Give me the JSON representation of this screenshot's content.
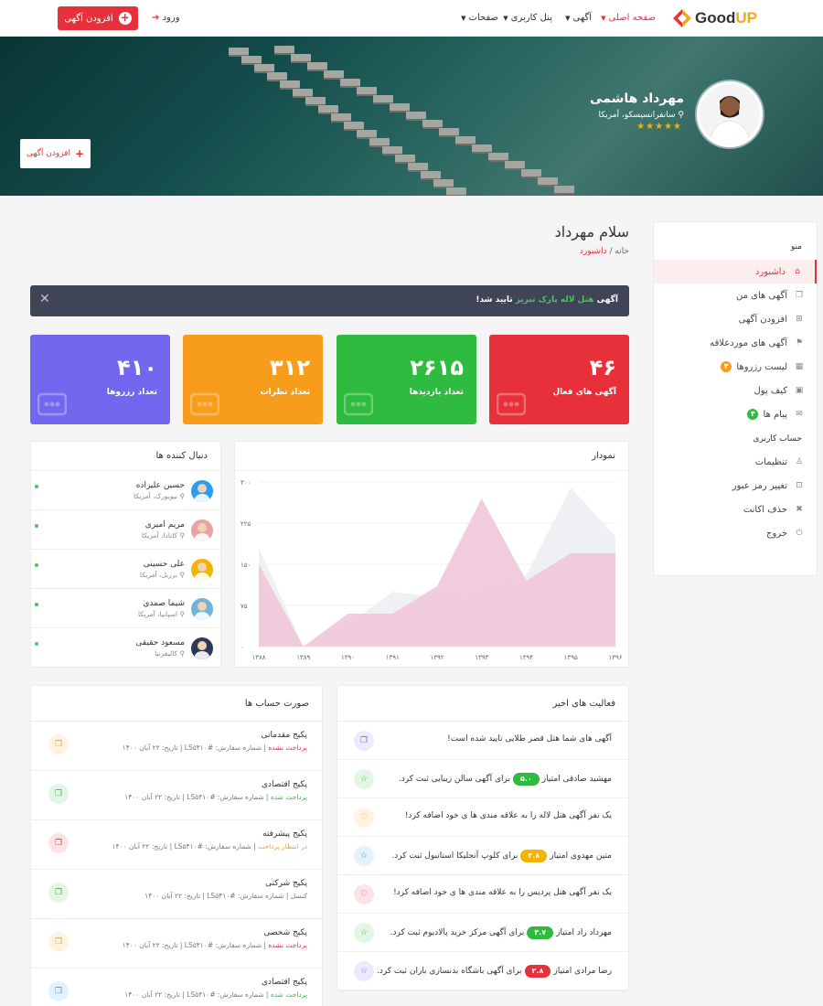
{
  "header": {
    "logo_text": "GoodUP",
    "nav": [
      {
        "label": "صفحه اصلی",
        "active": true
      },
      {
        "label": "آگهی"
      },
      {
        "label": "پنل کاربری"
      },
      {
        "label": "صفحات"
      }
    ],
    "login_label": "ورود",
    "add_listing_label": "افزودن آگهی"
  },
  "hero": {
    "user_name": "مهرداد هاشمی",
    "user_location": "سانفرانسیسکو، آمریکا",
    "stars": "★★★★★",
    "add_listing_label": "افزودن آگهی"
  },
  "sidebar": {
    "menu_title": "منو",
    "items": [
      {
        "label": "داشبورد",
        "icon": "home-icon",
        "active": true
      },
      {
        "label": "آگهی های من",
        "icon": "layers-icon"
      },
      {
        "label": "افزودن آگهی",
        "icon": "file-plus-icon"
      },
      {
        "label": "آگهی های موردعلاقه",
        "icon": "bookmark-icon"
      },
      {
        "label": "لیست رزروها",
        "icon": "calendar-icon",
        "badge": "۴"
      },
      {
        "label": "کیف پول",
        "icon": "wallet-icon"
      },
      {
        "label": "پیام ها",
        "icon": "mail-icon",
        "badge": "۴"
      }
    ],
    "account_title": "حساب کاربری",
    "account_items": [
      {
        "label": "تنظیمات",
        "icon": "user-icon"
      },
      {
        "label": "تغییر رمز عبور",
        "icon": "lock-icon"
      },
      {
        "label": "حذف اکانت",
        "icon": "trash-icon"
      },
      {
        "label": "خروج",
        "icon": "power-icon"
      }
    ]
  },
  "main": {
    "greeting": "سلام مهرداد",
    "breadcrumb_home": "خانه",
    "breadcrumb_current": "داشبورد",
    "alert": {
      "prefix": "آگهی",
      "highlight": "هتل لاله پارک تبریز",
      "suffix": "تایید شد!"
    },
    "stats": [
      {
        "value": "۴۶",
        "label": "آگهی های فعال",
        "color": "#e8303a",
        "icon": "document-icon"
      },
      {
        "value": "۲۶۱۵",
        "label": "تعداد بازدیدها",
        "color": "#2fbb3f",
        "icon": "eye-icon"
      },
      {
        "value": "۳۱۲",
        "label": "تعداد نظرات",
        "color": "#f89c1c",
        "icon": "comment-icon"
      },
      {
        "value": "۴۱۰",
        "label": "تعداد رزروها",
        "color": "#7367f0",
        "icon": "wallet-icon"
      }
    ]
  },
  "chart_title": "نمودار",
  "chart_data": {
    "type": "area",
    "x": [
      "۱۳۸۸",
      "۱۳۸۹",
      "۱۳۹۰",
      "۱۳۹۱",
      "۱۳۹۲",
      "۱۳۹۳",
      "۱۳۹۴",
      "۱۳۹۵",
      "۱۳۹۶"
    ],
    "y_ticks": [
      "۰",
      "۷۵",
      "۱۵۰",
      "۲۲۵",
      "۳۰۰"
    ],
    "ylim": [
      0,
      300
    ],
    "series": [
      {
        "values": [
          150,
          0,
          60,
          60,
          110,
          270,
          120,
          170,
          170
        ],
        "color": "#f0c7d9"
      },
      {
        "values": [
          180,
          0,
          40,
          100,
          90,
          100,
          130,
          290,
          200
        ],
        "color": "#eef0f3"
      }
    ]
  },
  "followers": {
    "title": "دنبال کننده ها",
    "items": [
      {
        "name": "حسین علیزاده",
        "location": "نیویورک، آمریکا"
      },
      {
        "name": "مریم امیری",
        "location": "کانادا، آمریکا"
      },
      {
        "name": "علی حسینی",
        "location": "برزیل، آمریکا"
      },
      {
        "name": "شیما صمدی",
        "location": "اسپانیا، آمریکا"
      },
      {
        "name": "مسعود حقیقی",
        "location": "کالیفرنیا"
      }
    ]
  },
  "invoices": {
    "title": "صورت حساب ها",
    "order_label": "شماره سفارش: #LS۵۴۱۰",
    "date_label": "تاریخ: ۲۲ آبان ۱۴۰۰",
    "items": [
      {
        "name": "پکیج مقدماتی",
        "status": "پرداخت نشده",
        "status_color": "#e8303a",
        "icon_color": "#f89c1c"
      },
      {
        "name": "پکیج اقتصادی",
        "status": "پرداخت شده",
        "status_color": "#2fbb3f",
        "icon_color": "#2fbb3f"
      },
      {
        "name": "پکیج پیشرفته",
        "status": "در انتظار پرداخت",
        "status_color": "#f89c1c",
        "icon_color": "#e8303a"
      },
      {
        "name": "پکیج شرکتی",
        "status": "کنسل",
        "status_color": "#777777",
        "icon_color": "#2fbb3f"
      },
      {
        "name": "پکیج شخصی",
        "status": "پرداخت نشده",
        "status_color": "#e8303a",
        "icon_color": "#f89c1c"
      },
      {
        "name": "پکیج اقتصادی",
        "status": "پرداخت شده",
        "status_color": "#2fbb3f",
        "icon_color": "#2a9df4"
      }
    ]
  },
  "activities": {
    "title": "فعالیت های اخیر",
    "items": [
      {
        "before": "آگهی های شما هتل قصر طلایی تایید شده است!",
        "score": "",
        "after": "",
        "icon": "layers-icon",
        "icon_color": "#7367f0"
      },
      {
        "before": "مهشید صادقی امتیاز",
        "score": "۵.۰",
        "badge_color": "#2fbb3f",
        "after": "برای آگهی سالن زیبایی ثبت کرد.",
        "icon": "star-icon",
        "icon_color": "#2fbb3f"
      },
      {
        "before": "یک نفر آگهی هتل لاله را به علاقه مندی ها ی خود اضافه کرد!",
        "score": "",
        "after": "",
        "icon": "heart-icon",
        "icon_color": "#f89c1c"
      },
      {
        "before": "متین مهدوی امتیاز",
        "score": "۳.۸",
        "badge_color": "#f5b301",
        "after": "برای کلوپ آنجلیکا استانبول ثبت کرد.",
        "icon": "star-icon",
        "icon_color": "#2a9df4"
      },
      {
        "before": "یک نفر آگهی هتل پردیس را به علاقه مندی ها ی خود اضافه کرد!",
        "score": "",
        "after": "",
        "icon": "heart-icon",
        "icon_color": "#e8303a"
      },
      {
        "before": "مهرداد راد امتیاز",
        "score": "۴.۷",
        "badge_color": "#2fbb3f",
        "after": "برای آگهی مرکز خرید پالادیوم ثبت کرد.",
        "icon": "star-icon",
        "icon_color": "#2fbb3f"
      },
      {
        "before": "رضا مرادی امتیاز",
        "score": "۲.۸",
        "badge_color": "#e8303a",
        "after": "برای آگهی باشگاه بدنسازی باران ثبت کرد.",
        "icon": "star-icon",
        "icon_color": "#7367f0"
      }
    ]
  }
}
